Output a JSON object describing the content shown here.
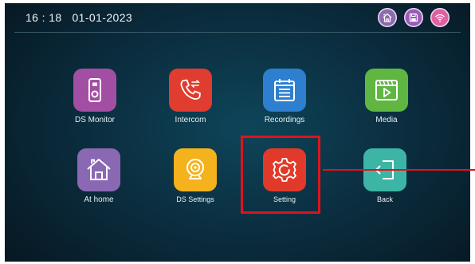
{
  "status_bar": {
    "time": "16 : 18",
    "date": "01-01-2023",
    "icons": [
      {
        "icon": "home-icon",
        "color": "#8e6bb0"
      },
      {
        "icon": "save-icon",
        "color": "#9a5cb8"
      },
      {
        "icon": "wifi-icon",
        "color": "#e060a0"
      }
    ]
  },
  "apps": [
    {
      "id": "ds-monitor",
      "label": "DS Monitor",
      "icon": "intercom-panel-icon",
      "color": "#a24fa3"
    },
    {
      "id": "intercom",
      "label": "Intercom",
      "icon": "phone-call-icon",
      "color": "#e03c2f"
    },
    {
      "id": "recordings",
      "label": "Recordings",
      "icon": "calendar-list-icon",
      "color": "#2e7fd0"
    },
    {
      "id": "media",
      "label": "Media",
      "icon": "film-play-icon",
      "color": "#5fb742"
    },
    {
      "id": "at-home",
      "label": "At home",
      "icon": "house-icon",
      "color": "#8a68b4"
    },
    {
      "id": "ds-settings",
      "label": "DS Settings",
      "icon": "camera-icon",
      "color": "#f4b21c"
    },
    {
      "id": "setting",
      "label": "Setting",
      "icon": "gear-icon",
      "color": "#e23a2a"
    },
    {
      "id": "back",
      "label": "Back",
      "icon": "exit-arrow-icon",
      "color": "#3db5a6"
    }
  ],
  "annotation": {
    "color": "#e1121b",
    "target": "setting"
  }
}
